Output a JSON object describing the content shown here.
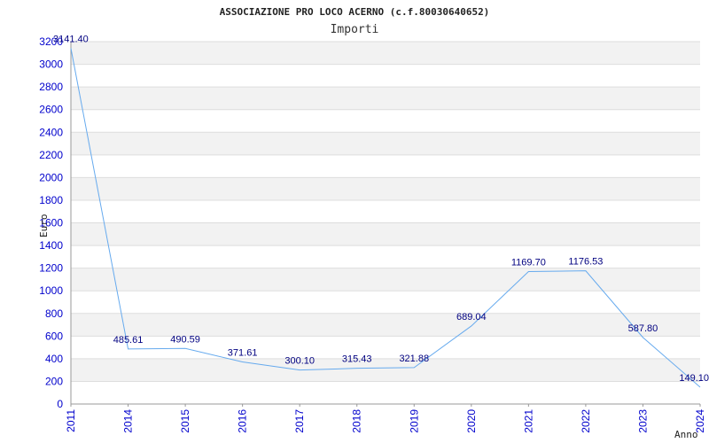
{
  "chart_data": {
    "type": "line",
    "title": "ASSOCIAZIONE PRO LOCO ACERNO (c.f.80030640652)",
    "subtitle": "Importi",
    "ylabel": "Euro",
    "xlabel": "Anno",
    "categories": [
      "2011",
      "2014",
      "2015",
      "2016",
      "2017",
      "2018",
      "2019",
      "2020",
      "2021",
      "2022",
      "2023",
      "2024"
    ],
    "values": [
      3141.4,
      485.61,
      490.59,
      371.61,
      300.1,
      315.43,
      321.88,
      689.04,
      1169.7,
      1176.53,
      587.8,
      149.1
    ],
    "value_labels": [
      "3141.40",
      "485.61",
      "490.59",
      "371.61",
      "300.10",
      "315.43",
      "321.88",
      "689.04",
      "1169.70",
      "1176.53",
      "587.80",
      "149.10"
    ],
    "ylim": [
      0,
      3200
    ],
    "yticks": [
      "0",
      "200",
      "400",
      "600",
      "800",
      "1000",
      "1200",
      "1400",
      "1600",
      "1800",
      "2000",
      "2200",
      "2400",
      "2600",
      "2800",
      "3000",
      "3200"
    ],
    "grid": true,
    "colors": {
      "line": "#66aaee",
      "band": "#f2f2f2",
      "grid": "#dddddd",
      "tick_text": "#0000cc",
      "label_text": "#000080"
    }
  }
}
